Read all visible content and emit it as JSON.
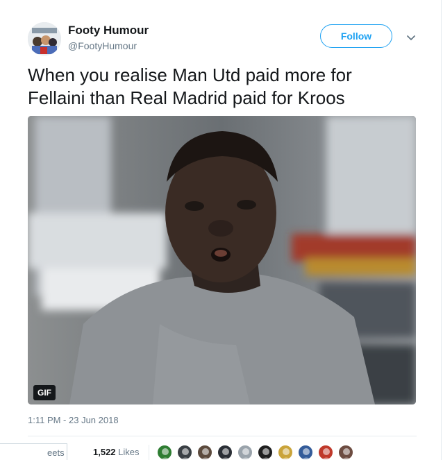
{
  "tweet": {
    "author_name": "Footy Humour",
    "author_handle": "@FootyHumour",
    "follow_label": "Follow",
    "text_line1": "When you realise Man Utd paid more for",
    "text_line2": "Fellaini than Real Madrid paid for Kroos",
    "gif_label": "GIF",
    "timestamp": "1:11 PM - 23 Jun 2018",
    "retweets_label": "eets",
    "likes_count": "1,522",
    "likes_label": "Likes",
    "liker_count": 10
  }
}
